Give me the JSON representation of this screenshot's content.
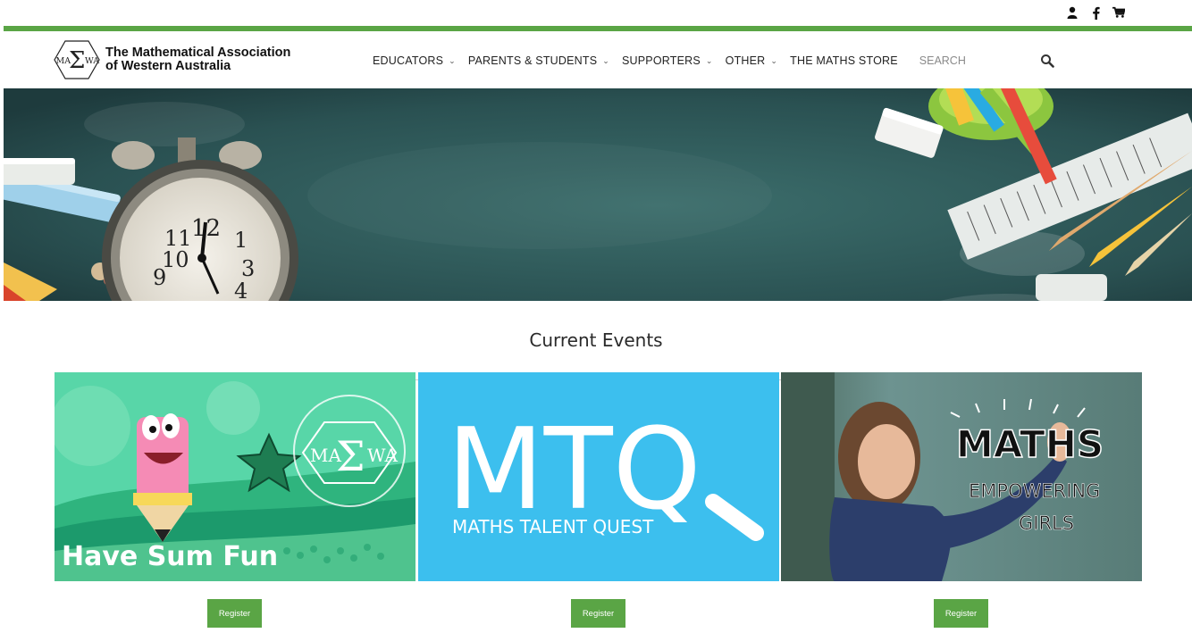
{
  "header": {
    "logo_line1": "The Mathematical Association",
    "logo_line2": "of Western Australia"
  },
  "nav": {
    "items": [
      {
        "label": "EDUCATORS",
        "dropdown": true
      },
      {
        "label": "PARENTS & STUDENTS",
        "dropdown": true
      },
      {
        "label": "SUPPORTERS",
        "dropdown": true
      },
      {
        "label": "OTHER",
        "dropdown": true
      },
      {
        "label": "THE MATHS STORE",
        "dropdown": false
      }
    ],
    "search_placeholder": "SEARCH"
  },
  "topbar_icons": [
    "user-icon",
    "facebook-icon",
    "cart-icon"
  ],
  "events": {
    "title": "Current Events",
    "cards": [
      {
        "image_text": "Have Sum Fun",
        "register_label": "Register"
      },
      {
        "image_text": "MTQ",
        "image_subtext": "MATHS TALENT QUEST",
        "register_label": "Register"
      },
      {
        "image_text": "MATHS",
        "image_subtext_1": "EMPOWERING",
        "image_subtext_2": "GIRLS",
        "register_label": "Register"
      }
    ]
  },
  "colors": {
    "brand_green": "#5aa545",
    "mtq_blue": "#3cbfee",
    "chalkboard": "#2f5a5a"
  }
}
